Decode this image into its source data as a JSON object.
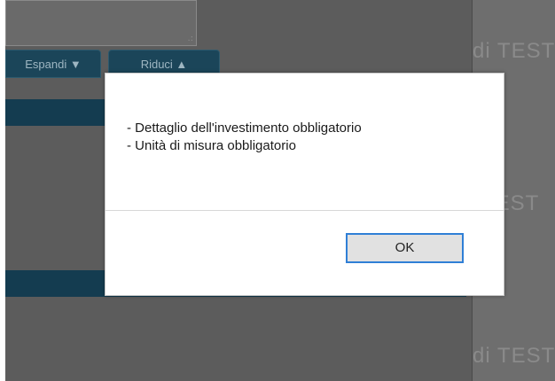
{
  "background_app": {
    "buttons": {
      "expand_label": "Espandi ▼",
      "reduce_label": "Riduci ▲"
    },
    "ghost_texts": [
      "di TEST",
      "TEST",
      "di TEST"
    ],
    "resize_grip": ".:"
  },
  "dialog": {
    "messages": [
      "- Dettaglio dell'investimento obbligatorio",
      "- Unità di misura obbligatorio"
    ],
    "ok_label": "OK"
  },
  "colors": {
    "overlay": "#5c5c5c",
    "bar": "#143c50",
    "button": "#1b4559",
    "ok_focus_border": "#2f7fd6"
  }
}
